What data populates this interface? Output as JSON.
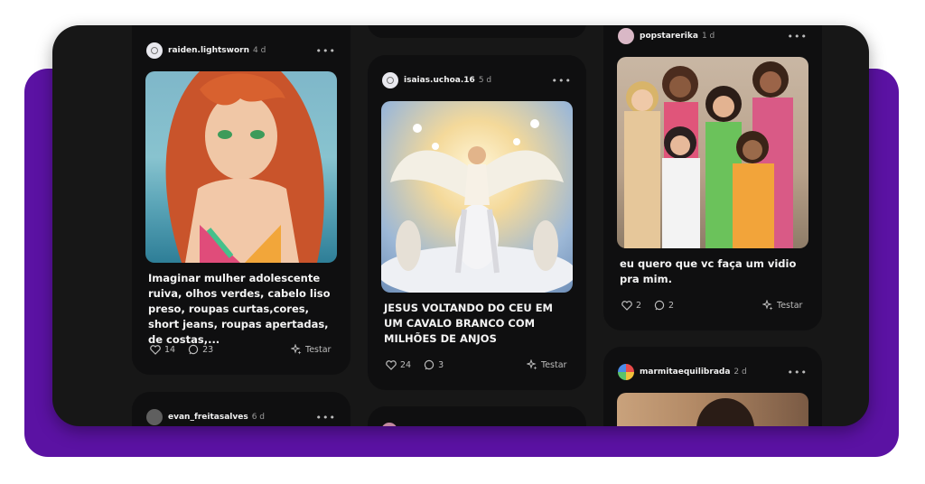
{
  "colors": {
    "accent_purple": "#5b12a3",
    "panel": "#171717",
    "card": "#0f0f10"
  },
  "posts": [
    {
      "username": "raiden.lightsworn",
      "time": "4 d",
      "caption": "Imaginar mulher adolescente ruiva, olhos verdes, cabelo liso preso, roupas curtas,cores, short jeans, roupas apertadas, de costas,...",
      "likes": "14",
      "comments": "23",
      "try_label": "Testar"
    },
    {
      "username": "isaias.uchoa.16",
      "time": "5 d",
      "caption": "JESUS VOLTANDO DO CEU EM UM CAVALO BRANCO COM MILHÕES DE ANJOS",
      "likes": "24",
      "comments": "3",
      "try_label": "Testar"
    },
    {
      "username": "popstarerika",
      "time": "1 d",
      "caption": "eu quero que vc faça um vidio pra mim.",
      "likes": "2",
      "comments": "2",
      "try_label": "Testar"
    },
    {
      "username": "evan_freitasalves",
      "time": "6 d"
    },
    {
      "username": "marmitaequilibrada",
      "time": "2 d"
    }
  ],
  "icons": {
    "like": "heart-icon",
    "comment": "comment-bubble-icon",
    "try": "sparkle-icon",
    "more": "more-dots-icon"
  }
}
